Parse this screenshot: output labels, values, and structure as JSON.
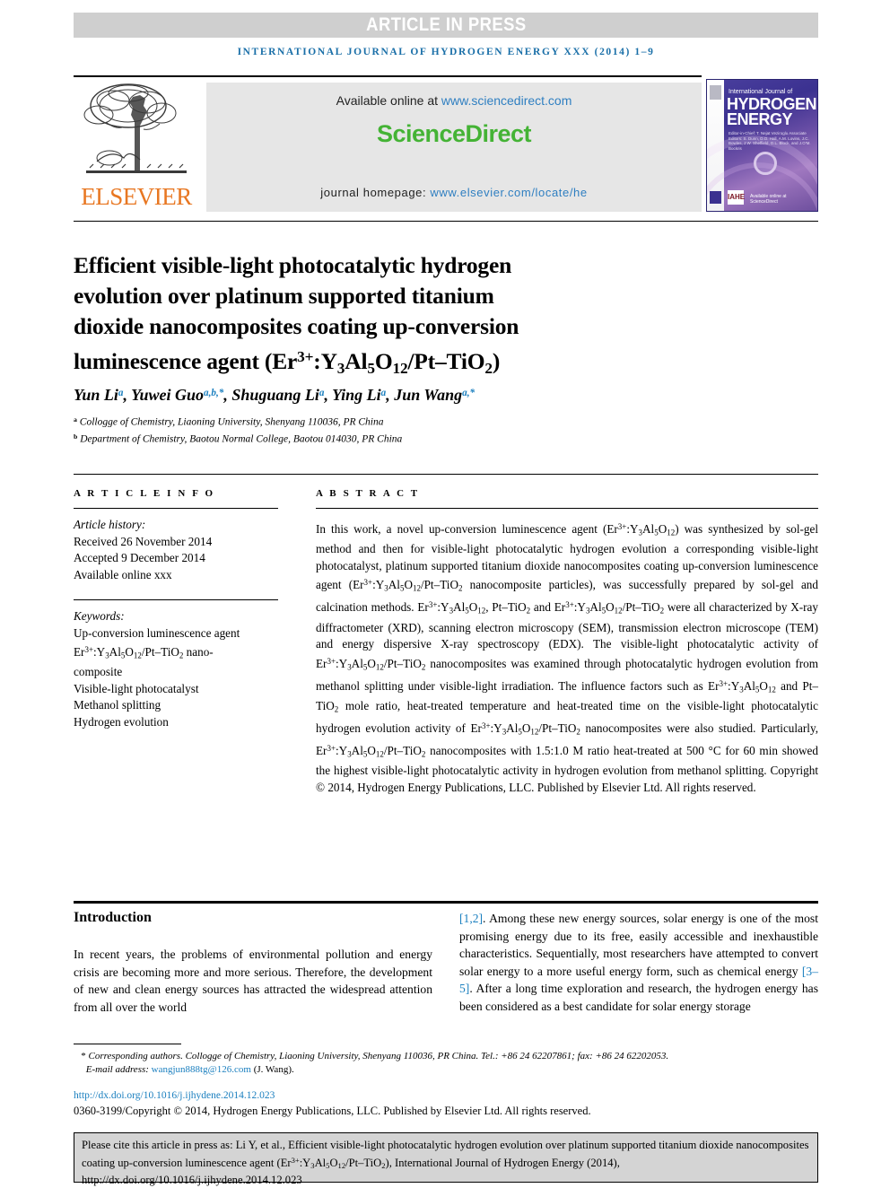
{
  "banner": {
    "text": "ARTICLE IN PRESS",
    "bg": "#cfcfcf",
    "fg": "#ffffff"
  },
  "running_head": "INTERNATIONAL JOURNAL OF HYDROGEN ENERGY XXX (2014) 1–9",
  "masthead": {
    "publisher": "ELSEVIER",
    "available_label": "Available online at ",
    "available_url": "www.sciencedirect.com",
    "sciencedirect_logo": "ScienceDirect",
    "homepage_label": "journal homepage: ",
    "homepage_url": "www.elsevier.com/locate/he",
    "sd_green": "#44b335",
    "link_blue": "#2f7fc1"
  },
  "cover": {
    "subtitle": "International Journal of",
    "title_line1": "HYDROGEN",
    "title_line2": "ENERGY",
    "editors": "Editor-in-Chief: T. Nejat Veziroglu    Associate Editors: S. Dunn, D.O. Hall, A.M. Lovins, J.C. Bowles, J.W. Sheffield, D.L. Block, and J.O'M. Bockris",
    "badge": "IAHE",
    "sd_mark": "Available online at ScienceDirect"
  },
  "title": {
    "line1": "Efficient visible-light photocatalytic hydrogen",
    "line2": "evolution over platinum supported titanium",
    "line3": "dioxide nanocomposites coating up-conversion",
    "line4_pre": "luminescence agent (Er",
    "line4_sup": "3+",
    "line4_mid": ":Y",
    "line4_sub1": "3",
    "line4_al": "Al",
    "line4_sub2": "5",
    "line4_o": "O",
    "line4_sub3": "12",
    "line4_post": "/Pt–TiO",
    "line4_sub4": "2",
    "line4_close": ")"
  },
  "authors": {
    "list": "Yun Li ᵃ, Yuwei Guo ᵃ,ᵇ,*, Shuguang Li ᵃ, Ying Li ᵃ, Jun Wang ᵃ,*",
    "names": [
      {
        "name": "Yun Li",
        "marks": "a"
      },
      {
        "name": "Yuwei Guo",
        "marks": "a,b,*"
      },
      {
        "name": "Shuguang Li",
        "marks": "a"
      },
      {
        "name": "Ying Li",
        "marks": "a"
      },
      {
        "name": "Jun Wang",
        "marks": "a,*"
      }
    ],
    "affiliations": [
      {
        "mark": "a",
        "text": "Collogge of Chemistry, Liaoning University, Shenyang 110036, PR China"
      },
      {
        "mark": "b",
        "text": "Department of Chemistry, Baotou Normal College, Baotou 014030, PR China"
      }
    ]
  },
  "article_info": {
    "heading": "A R T I C L E   I N F O",
    "history_label": "Article history:",
    "history": [
      "Received 26 November 2014",
      "Accepted 9 December 2014",
      "Available online xxx"
    ],
    "keywords_label": "Keywords:",
    "keywords": [
      "Up-conversion luminescence agent",
      "Er3+:Y3Al5O12/Pt–TiO2 nano-composite",
      "Visible-light photocatalyst",
      "Methanol splitting",
      "Hydrogen evolution"
    ]
  },
  "abstract": {
    "heading": "A B S T R A C T",
    "body_main": "In this work, a novel up-conversion luminescence agent (Er3+:Y3Al5O12) was synthesized by sol-gel method and then for visible-light photocatalytic hydrogen evolution a corresponding visible-light photocatalyst, platinum supported titanium dioxide nanocomposites coating up-conversion luminescence agent (Er3+:Y3Al5O12/Pt–TiO2 nanocomposite particles), was successfully prepared by sol-gel and calcination methods. Er3+:Y3Al5O12, Pt–TiO2 and Er3+:Y3Al5O12/Pt–TiO2 were all characterized by X-ray diffractometer (XRD), scanning electron microscopy (SEM), transmission electron microscope (TEM) and energy dispersive X-ray spectroscopy (EDX). The visible-light photocatalytic activity of Er3+:Y3Al5O12/Pt–TiO2 nanocomposites was examined through photocatalytic hydrogen evolution from methanol splitting under visible-light irradiation. The influence factors such as Er3+:Y3Al5O12 and Pt–TiO2 mole ratio, heat-treated temperature and heat-treated time on the visible-light photocatalytic hydrogen evolution activity of Er3+:Y3Al5O12/Pt–TiO2 nanocomposites were also studied. Particularly, Er3+:Y3Al5O12/Pt–TiO2 nanocomposites with 1.5:1.0 M ratio heat-treated at 500 °C for 60 min showed the highest visible-light photocatalytic activity in hydrogen evolution from methanol splitting.",
    "copyright": "Copyright © 2014, Hydrogen Energy Publications, LLC. Published by Elsevier Ltd. All rights reserved."
  },
  "introduction": {
    "heading": "Introduction",
    "left_text": "In recent years, the problems of environmental pollution and energy crisis are becoming more and more serious. Therefore, the development of new and clean energy sources has attracted the widespread attention from all over the world",
    "right_ref1": "[1,2]",
    "right_text_a": ". Among these new energy sources, solar energy is one of the most promising energy due to its free, easily accessible and inexhaustible characteristics. Sequentially, most researchers have attempted to convert solar energy to a more useful energy form, such as chemical energy ",
    "right_ref2": "[3–5]",
    "right_text_b": ". After a long time exploration and research, the hydrogen energy has been considered as a best candidate for solar energy storage"
  },
  "footnotes": {
    "corresponding": "Corresponding authors. Collogge of Chemistry, Liaoning University, Shenyang 110036, PR China. Tel.: +86 24 62207861; fax: +86 24 62202053.",
    "email_label": "E-mail address: ",
    "email": "wangjun888tg@126.com",
    "email_suffix": " (J. Wang).",
    "doi": "http://dx.doi.org/10.1016/j.ijhydene.2014.12.023",
    "issn_copyright": "0360-3199/Copyright © 2014, Hydrogen Energy Publications, LLC. Published by Elsevier Ltd. All rights reserved."
  },
  "cite_box": {
    "prefix": "Please cite this article in press as: Li Y, et al., Efficient visible-light photocatalytic hydrogen evolution over platinum supported titanium dioxide nanocomposites coating up-conversion luminescence agent (Er",
    "sup": "3+",
    "mid": ":Y",
    "sub1": "3",
    "al": "Al",
    "sub2": "5",
    "o": "O",
    "sub3": "12",
    "post": "/Pt–TiO",
    "sub4": "2",
    "suffix": "), International Journal of Hydrogen Energy (2014), http://dx.doi.org/10.1016/j.ijhydene.2014.12.023"
  }
}
